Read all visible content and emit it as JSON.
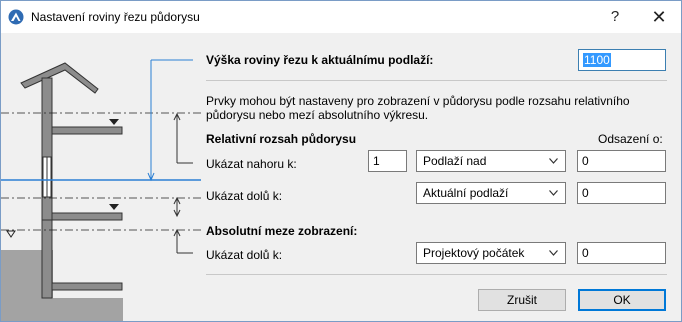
{
  "window": {
    "title": "Nastavení roviny řezu půdorysu",
    "help_label": "?",
    "close_label": "✕",
    "app_icon": "archicad-logo-icon"
  },
  "cut_height": {
    "label": "Výška roviny řezu k aktuálnímu podlaží:",
    "value": "1100"
  },
  "description": "Prvky mohou být nastaveny pro zobrazení v půdorysu podle rozsahu relativního půdorysu nebo mezí absolutního výkresu.",
  "relative": {
    "heading": "Relativní rozsah půdorysu",
    "offset_heading": "Odsazení o:",
    "top": {
      "label": "Ukázat nahoru k:",
      "count": "1",
      "story": "Podlaží nad",
      "offset": "0"
    },
    "bottom": {
      "label": "Ukázat dolů k:",
      "story": "Aktuální podlaží",
      "offset": "0"
    }
  },
  "absolute": {
    "heading": "Absolutní meze zobrazení:",
    "bottom": {
      "label": "Ukázat dolů k:",
      "reference": "Projektový počátek",
      "offset": "0"
    }
  },
  "buttons": {
    "cancel": "Zrušit",
    "ok": "OK"
  },
  "colors": {
    "cut_plane": "#2a7fd4",
    "leader": "#3b6fc4",
    "accent": "#0078d7"
  }
}
